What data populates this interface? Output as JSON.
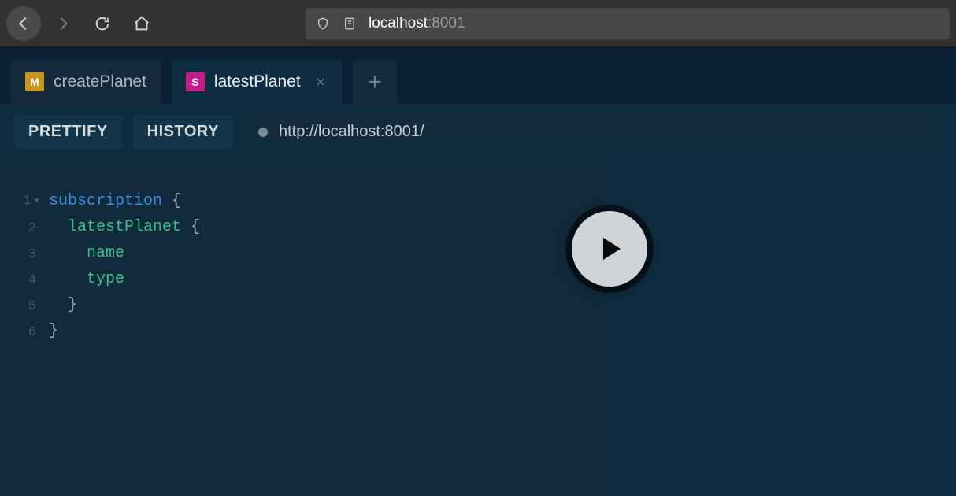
{
  "browser": {
    "url_host": "localhost",
    "url_port": ":8001"
  },
  "tabs": [
    {
      "badge": "M",
      "label": "createPlanet",
      "active": false
    },
    {
      "badge": "S",
      "label": "latestPlanet",
      "active": true
    }
  ],
  "toolbar": {
    "prettify_label": "PRETTIFY",
    "history_label": "HISTORY",
    "endpoint_url": "http://localhost:8001/"
  },
  "editor": {
    "line_numbers": [
      "1",
      "2",
      "3",
      "4",
      "5",
      "6"
    ],
    "code_tokens": {
      "l1_kw": "subscription",
      "l1_brace": " {",
      "l2_field": "latestPlanet",
      "l2_brace": " {",
      "l3_field": "name",
      "l4_field": "type",
      "l5_brace": "}",
      "l6_brace": "}"
    }
  }
}
